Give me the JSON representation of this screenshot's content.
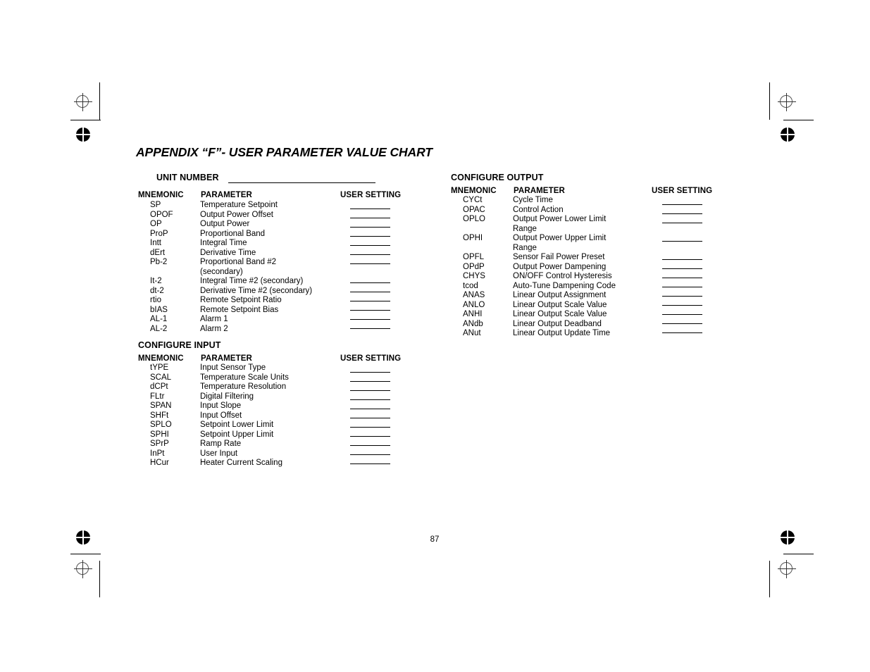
{
  "document": {
    "title": "APPENDIX “F”- USER PARAMETER VALUE CHART",
    "page_number": "87"
  },
  "unit_number": {
    "label": "UNIT NUMBER",
    "value": ""
  },
  "column_headers": {
    "mnemonic": "MNEMONIC",
    "parameter": "PARAMETER",
    "user_setting": "USER SETTING"
  },
  "sections": [
    {
      "id": "unit-number-section",
      "heading": "UNIT NUMBER",
      "rows": [
        {
          "mnemonic": "SP",
          "parameter": "Temperature Setpoint",
          "setting": ""
        },
        {
          "mnemonic": "OPOF",
          "parameter": "Output Power Offset",
          "setting": ""
        },
        {
          "mnemonic": "OP",
          "parameter": "Output Power",
          "setting": ""
        },
        {
          "mnemonic": "ProP",
          "parameter": "Proportional Band",
          "setting": ""
        },
        {
          "mnemonic": "Intt",
          "parameter": "Integral Time",
          "setting": ""
        },
        {
          "mnemonic": "dErt",
          "parameter": "Derivative Time",
          "setting": ""
        },
        {
          "mnemonic": "Pb-2",
          "parameter": "Proportional Band #2",
          "setting": ""
        },
        {
          "mnemonic": "",
          "parameter": "(secondary)",
          "setting": ""
        },
        {
          "mnemonic": "It-2",
          "parameter": "Integral Time #2 (secondary)",
          "setting": ""
        },
        {
          "mnemonic": "dt-2",
          "parameter": "Derivative Time #2 (secondary)",
          "setting": ""
        },
        {
          "mnemonic": "rtio",
          "parameter": "Remote Setpoint Ratio",
          "setting": ""
        },
        {
          "mnemonic": "bIAS",
          "parameter": "Remote Setpoint Bias",
          "setting": ""
        },
        {
          "mnemonic": "AL-1",
          "parameter": "Alarm 1",
          "setting": ""
        },
        {
          "mnemonic": "AL-2",
          "parameter": "Alarm 2",
          "setting": ""
        }
      ]
    },
    {
      "id": "configure-input-section",
      "heading": "CONFIGURE INPUT",
      "rows": [
        {
          "mnemonic": "tYPE",
          "parameter": "Input Sensor Type",
          "setting": ""
        },
        {
          "mnemonic": "SCAL",
          "parameter": "Temperature Scale Units",
          "setting": ""
        },
        {
          "mnemonic": "dCPt",
          "parameter": "Temperature Resolution",
          "setting": ""
        },
        {
          "mnemonic": "FLtr",
          "parameter": "Digital Filtering",
          "setting": ""
        },
        {
          "mnemonic": "SPAN",
          "parameter": "Input Slope",
          "setting": ""
        },
        {
          "mnemonic": "SHFt",
          "parameter": "Input Offset",
          "setting": ""
        },
        {
          "mnemonic": "SPLO",
          "parameter": "Setpoint Lower Limit",
          "setting": ""
        },
        {
          "mnemonic": "SPHI",
          "parameter": "Setpoint Upper Limit",
          "setting": ""
        },
        {
          "mnemonic": "SPrP",
          "parameter": "Ramp Rate",
          "setting": ""
        },
        {
          "mnemonic": "InPt",
          "parameter": "User Input",
          "setting": ""
        },
        {
          "mnemonic": "HCur",
          "parameter": "Heater Current Scaling",
          "setting": ""
        }
      ]
    },
    {
      "id": "configure-output-section",
      "heading": "CONFIGURE OUTPUT",
      "rows": [
        {
          "mnemonic": "CYCt",
          "parameter": "Cycle Time",
          "setting": ""
        },
        {
          "mnemonic": "OPAC",
          "parameter": "Control Action",
          "setting": ""
        },
        {
          "mnemonic": "OPLO",
          "parameter": "Output Power Lower Limit",
          "setting": ""
        },
        {
          "mnemonic": "",
          "parameter": "Range",
          "setting": ""
        },
        {
          "mnemonic": "OPHI",
          "parameter": "Output Power Upper Limit",
          "setting": ""
        },
        {
          "mnemonic": "",
          "parameter": "Range",
          "setting": ""
        },
        {
          "mnemonic": "OPFL",
          "parameter": "Sensor Fail Power Preset",
          "setting": ""
        },
        {
          "mnemonic": "OPdP",
          "parameter": "Output Power Dampening",
          "setting": ""
        },
        {
          "mnemonic": "CHYS",
          "parameter": "ON/OFF Control Hysteresis",
          "setting": ""
        },
        {
          "mnemonic": "tcod",
          "parameter": "Auto-Tune Dampening Code",
          "setting": ""
        },
        {
          "mnemonic": "ANAS",
          "parameter": "Linear Output Assignment",
          "setting": ""
        },
        {
          "mnemonic": "ANLO",
          "parameter": "Linear Output Scale Value",
          "setting": ""
        },
        {
          "mnemonic": "ANHI",
          "parameter": "Linear Output Scale Value",
          "setting": ""
        },
        {
          "mnemonic": "ANdb",
          "parameter": "Linear Output Deadband",
          "setting": ""
        },
        {
          "mnemonic": "ANut",
          "parameter": "Linear Output Update Time",
          "setting": ""
        }
      ]
    }
  ],
  "marks": {
    "registration_target": "registration-target-icon",
    "registration_dot": "registration-dot-icon"
  }
}
